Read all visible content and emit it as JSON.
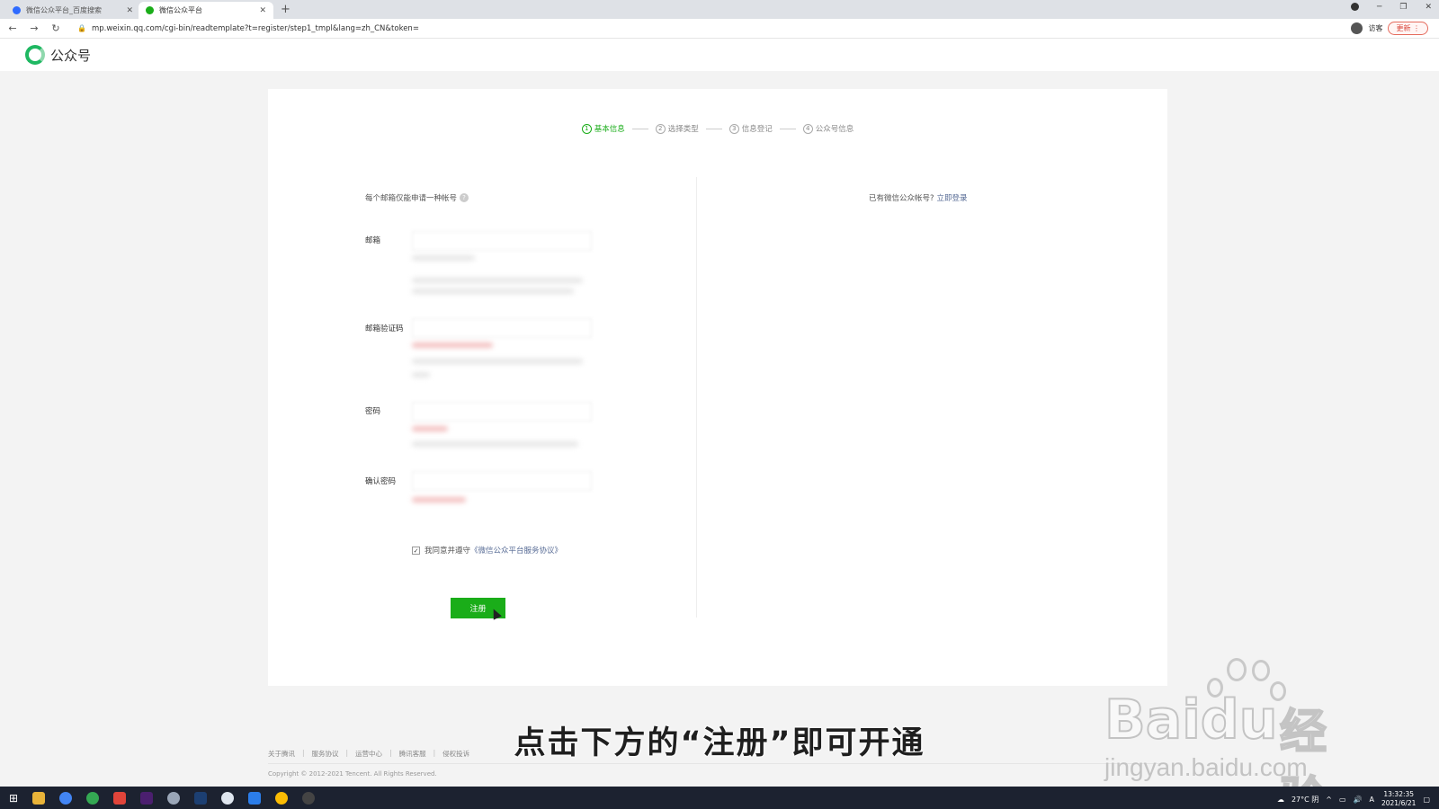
{
  "browser": {
    "tabs": [
      {
        "label": "微信公众平台_百度搜索",
        "active": false,
        "favicon_color": "#2f6bff"
      },
      {
        "label": "微信公众平台",
        "active": true,
        "favicon_color": "#1aad19"
      }
    ],
    "new_tab_label": "+",
    "url": "mp.weixin.qq.com/cgi-bin/readtemplate?t=register/step1_tmpl&lang=zh_CN&token=",
    "user_label": "访客",
    "update_label": "更新"
  },
  "header": {
    "logo_text": "公众号"
  },
  "steps": [
    {
      "num": "1",
      "label": "基本信息",
      "active": true
    },
    {
      "num": "2",
      "label": "选择类型",
      "active": false
    },
    {
      "num": "3",
      "label": "信息登记",
      "active": false
    },
    {
      "num": "4",
      "label": "公众号信息",
      "active": false
    }
  ],
  "form": {
    "notice": "每个邮箱仅能申请一种帐号",
    "login_tip": "已有微信公众帐号?",
    "login_link": "立即登录",
    "fields": {
      "email": "邮箱",
      "email_code": "邮箱验证码",
      "password": "密码",
      "confirm_password": "确认密码"
    },
    "agree_prefix": "我同意并遵守",
    "agree_link": "《微信公众平台服务协议》",
    "agree_checked": true,
    "register_label": "注册"
  },
  "footer": {
    "links": [
      "关于腾讯",
      "服务协议",
      "运营中心",
      "腾讯客服",
      "侵权投诉"
    ],
    "copyright": "Copyright © 2012-2021 Tencent. All Rights Reserved."
  },
  "subtitle": "点击下方的“注册”即可开通",
  "watermark": {
    "brand": "Baidu",
    "brand_cn": "经验",
    "url": "jingyan.baidu.com"
  },
  "taskbar": {
    "weather": "27°C 阴",
    "time": "13:32:35",
    "date": "2021/6/21"
  },
  "colors": {
    "brand_green": "#1aad19",
    "link": "#576b95"
  }
}
